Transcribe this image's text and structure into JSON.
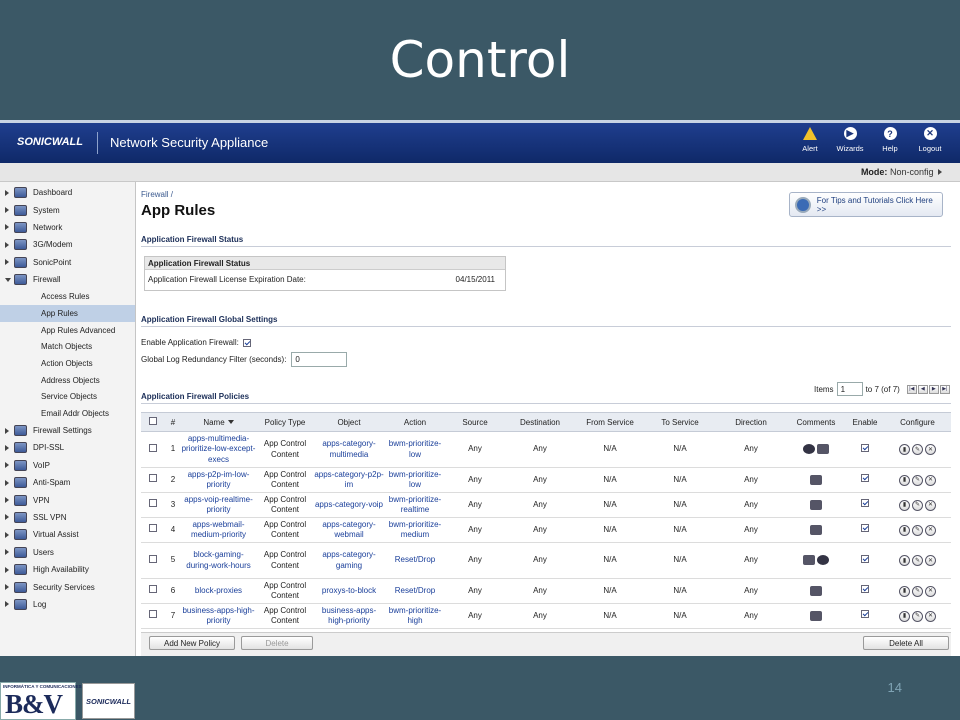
{
  "slide": {
    "title": "Control",
    "page_number": "14",
    "logo_bv_small": "INFORMÁTICA Y COMUNICACIONES",
    "logo_bv_big": "B&V",
    "logo_sw": "SONICWALL"
  },
  "header": {
    "brand": "SONICWALL",
    "product": "Network Security Appliance",
    "nav": [
      {
        "label": "Alert",
        "glyph": "!"
      },
      {
        "label": "Wizards",
        "glyph": "▶"
      },
      {
        "label": "Help",
        "glyph": "?"
      },
      {
        "label": "Logout",
        "glyph": "✕"
      }
    ]
  },
  "mode": {
    "label": "Mode:",
    "value": "Non-config"
  },
  "sidebar": {
    "items": [
      {
        "label": "Dashboard",
        "open": false
      },
      {
        "label": "System",
        "open": false
      },
      {
        "label": "Network",
        "open": false
      },
      {
        "label": "3G/Modem",
        "open": false
      },
      {
        "label": "SonicPoint",
        "open": false
      },
      {
        "label": "Firewall",
        "open": true,
        "children": [
          {
            "label": "Access Rules",
            "active": false
          },
          {
            "label": "App Rules",
            "active": true
          },
          {
            "label": "App Rules Advanced",
            "active": false
          },
          {
            "label": "Match Objects",
            "active": false
          },
          {
            "label": "Action Objects",
            "active": false
          },
          {
            "label": "Address Objects",
            "active": false
          },
          {
            "label": "Service Objects",
            "active": false
          },
          {
            "label": "Email Addr Objects",
            "active": false
          }
        ]
      },
      {
        "label": "Firewall Settings",
        "open": false
      },
      {
        "label": "DPI-SSL",
        "open": false
      },
      {
        "label": "VoIP",
        "open": false
      },
      {
        "label": "Anti-Spam",
        "open": false
      },
      {
        "label": "VPN",
        "open": false
      },
      {
        "label": "SSL VPN",
        "open": false
      },
      {
        "label": "Virtual Assist",
        "open": false
      },
      {
        "label": "Users",
        "open": false
      },
      {
        "label": "High Availability",
        "open": false
      },
      {
        "label": "Security Services",
        "open": false
      },
      {
        "label": "Log",
        "open": false
      }
    ]
  },
  "main": {
    "breadcrumb": "Firewall /",
    "title": "App Rules",
    "tips_button": "For Tips and Tutorials Click Here >>",
    "status_section": "Application Firewall Status",
    "status_box_title": "Application Firewall Status",
    "license_label": "Application Firewall License Expiration Date:",
    "license_value": "04/15/2011",
    "global_section": "Application Firewall Global Settings",
    "enable_label": "Enable Application Firewall:",
    "enable_checked": true,
    "log_filter_label": "Global Log Redundancy Filter (seconds):",
    "log_filter_value": "0",
    "policies_section": "Application Firewall Policies",
    "items_label": "Items",
    "items_value": "1",
    "items_suffix": "to 7 (of 7)",
    "pager": [
      "|◀",
      "◀",
      "▶",
      "▶|"
    ],
    "table": {
      "columns": [
        "#",
        "Name",
        "Policy Type",
        "Object",
        "Action",
        "Source",
        "Destination",
        "From Service",
        "To Service",
        "Direction",
        "Comments",
        "Enable",
        "Configure"
      ],
      "rows": [
        {
          "num": "1",
          "name": "apps-multimedia-prioritize-low-except-execs",
          "policy_type": "App Control Content",
          "object": "apps-category-multimedia",
          "action": "bwm-prioritize-low",
          "source": "Any",
          "destination": "Any",
          "from_service": "N/A",
          "to_service": "N/A",
          "direction": "Any",
          "comments": "people-notes",
          "enabled": true
        },
        {
          "num": "2",
          "name": "apps-p2p-im-low-priority",
          "policy_type": "App Control Content",
          "object": "apps-category-p2p-im",
          "action": "bwm-prioritize-low",
          "source": "Any",
          "destination": "Any",
          "from_service": "N/A",
          "to_service": "N/A",
          "direction": "Any",
          "comments": "notes",
          "enabled": true
        },
        {
          "num": "3",
          "name": "apps-voip-realtime-priority",
          "policy_type": "App Control Content",
          "object": "apps-category-voip",
          "action": "bwm-prioritize-realtime",
          "source": "Any",
          "destination": "Any",
          "from_service": "N/A",
          "to_service": "N/A",
          "direction": "Any",
          "comments": "notes",
          "enabled": true
        },
        {
          "num": "4",
          "name": "apps-webmail-medium-priority",
          "policy_type": "App Control Content",
          "object": "apps-category-webmail",
          "action": "bwm-prioritize-medium",
          "source": "Any",
          "destination": "Any",
          "from_service": "N/A",
          "to_service": "N/A",
          "direction": "Any",
          "comments": "notes",
          "enabled": true
        },
        {
          "num": "5",
          "name": "block-gaming-during-work-hours",
          "policy_type": "App Control Content",
          "object": "apps-category-gaming",
          "action": "Reset/Drop",
          "source": "Any",
          "destination": "Any",
          "from_service": "N/A",
          "to_service": "N/A",
          "direction": "Any",
          "comments": "notes-clock",
          "enabled": true
        },
        {
          "num": "6",
          "name": "block-proxies",
          "policy_type": "App Control Content",
          "object": "proxys-to-block",
          "action": "Reset/Drop",
          "source": "Any",
          "destination": "Any",
          "from_service": "N/A",
          "to_service": "N/A",
          "direction": "Any",
          "comments": "notes",
          "enabled": true
        },
        {
          "num": "7",
          "name": "business-apps-high-priority",
          "policy_type": "App Control Content",
          "object": "business-apps-high-priority",
          "action": "bwm-prioritize-high",
          "source": "Any",
          "destination": "Any",
          "from_service": "N/A",
          "to_service": "N/A",
          "direction": "Any",
          "comments": "notes",
          "enabled": true
        }
      ]
    },
    "buttons": {
      "add": "Add New Policy",
      "delete": "Delete",
      "delete_all": "Delete All"
    }
  }
}
